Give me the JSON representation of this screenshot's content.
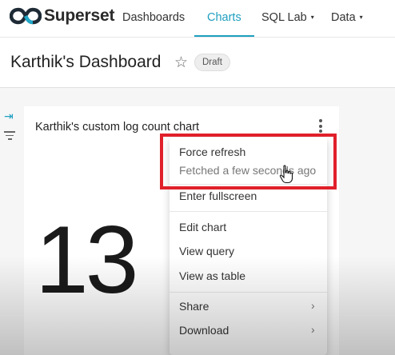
{
  "nav": {
    "brand": "Superset",
    "items": [
      {
        "label": "Dashboards",
        "active": false,
        "dropdown": false
      },
      {
        "label": "Charts",
        "active": true,
        "dropdown": false
      },
      {
        "label": "SQL Lab",
        "active": false,
        "dropdown": true
      },
      {
        "label": "Data",
        "active": false,
        "dropdown": true
      }
    ],
    "caret": "▾",
    "accent": "#1e9fbf"
  },
  "header": {
    "title": "Karthik's Dashboard",
    "star": "☆",
    "badge": "Draft"
  },
  "sidebar": {
    "collapse_icon": "expand-right-icon",
    "filter_icon": "filter-icon"
  },
  "chart": {
    "title": "Karthik's custom log count chart",
    "value": "13"
  },
  "menu": {
    "force_refresh": "Force refresh",
    "fetched": "Fetched a few seconds ago",
    "fullscreen": "Enter fullscreen",
    "edit_chart": "Edit chart",
    "view_query": "View query",
    "view_table": "View as table",
    "share": "Share",
    "download": "Download",
    "chevron": "›"
  },
  "annotation_color": "#e0202a"
}
